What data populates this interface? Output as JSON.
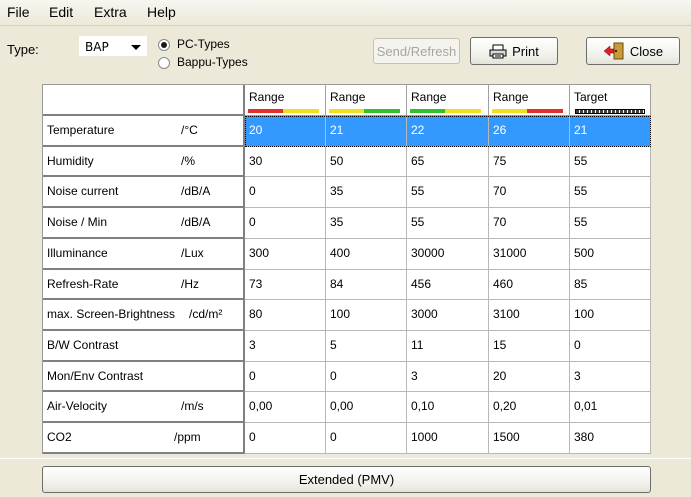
{
  "menu": [
    "File",
    "Edit",
    "Extra",
    "Help"
  ],
  "toolbar": {
    "type_label": "Type:",
    "type_value": "BAP",
    "radio_pc": "PC-Types",
    "radio_bappu": "Bappu-Types",
    "send_label": "Send/Refresh",
    "print_label": "Print",
    "close_label": "Close"
  },
  "grid": {
    "headers": [
      "Range",
      "Range",
      "Range",
      "Range",
      "Target"
    ],
    "header_bar_colors": [
      [
        "#e03030",
        "#f0e020"
      ],
      [
        "#f0e020",
        "#30c030"
      ],
      [
        "#30c030",
        "#f0e020"
      ],
      [
        "#f0e020",
        "#e03030"
      ],
      [
        "#404040",
        "#404040"
      ]
    ],
    "selected_row": 0,
    "selection_color": "#3399ff",
    "rows": [
      {
        "name": "Temperature",
        "unit": "/°C",
        "values": [
          "20",
          "21",
          "22",
          "26",
          "21"
        ]
      },
      {
        "name": "Humidity",
        "unit": "/%",
        "values": [
          "30",
          "50",
          "65",
          "75",
          "55"
        ]
      },
      {
        "name": "Noise current",
        "unit": "/dB/A",
        "values": [
          "0",
          "35",
          "55",
          "70",
          "55"
        ]
      },
      {
        "name": "Noise / Min",
        "unit": "/dB/A",
        "values": [
          "0",
          "35",
          "55",
          "70",
          "55"
        ]
      },
      {
        "name": "Illuminance",
        "unit": "/Lux",
        "values": [
          "300",
          "400",
          "30000",
          "31000",
          "500"
        ]
      },
      {
        "name": "Refresh-Rate",
        "unit": "/Hz",
        "values": [
          "73",
          "84",
          "456",
          "460",
          "85"
        ]
      },
      {
        "name": "max. Screen-Brightness",
        "unit": "/cd/m²",
        "values": [
          "80",
          "100",
          "3000",
          "3100",
          "100"
        ]
      },
      {
        "name": "B/W Contrast",
        "unit": "",
        "values": [
          "3",
          "5",
          "11",
          "15",
          "0"
        ]
      },
      {
        "name": "Mon/Env Contrast",
        "unit": "",
        "values": [
          "0",
          "0",
          "3",
          "20",
          "3"
        ]
      },
      {
        "name": "Air-Velocity",
        "unit": "/m/s",
        "values": [
          "0,00",
          "0,00",
          "0,10",
          "0,20",
          "0,01"
        ]
      },
      {
        "name": "CO2",
        "unit": "/ppm",
        "values": [
          "0",
          "0",
          "1000",
          "1500",
          "380"
        ]
      }
    ]
  },
  "extended_label": "Extended (PMV)"
}
